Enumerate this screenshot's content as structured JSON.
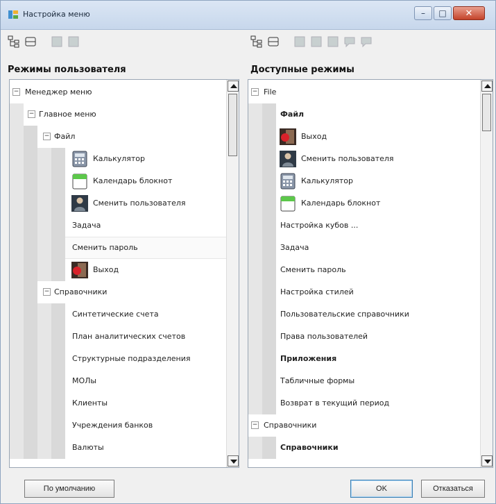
{
  "window": {
    "title": "Настройка меню",
    "min_glyph": "–",
    "max_glyph": "□",
    "close_glyph": "✕"
  },
  "left_panel": {
    "title": "Режимы пользователя",
    "rows": [
      {
        "label": "Менеджер меню",
        "toggle": "−"
      },
      {
        "label": "Главное меню",
        "toggle": "−"
      },
      {
        "label": "Файл",
        "toggle": "−"
      },
      {
        "label": "Калькулятор",
        "icon": "calculator-icon"
      },
      {
        "label": "Календарь блокнот",
        "icon": "calendar-icon"
      },
      {
        "label": "Сменить пользователя",
        "icon": "user-icon"
      },
      {
        "label": "Задача"
      },
      {
        "label": "Сменить пароль"
      },
      {
        "label": "Выход",
        "icon": "exit-icon"
      },
      {
        "label": "Справочники",
        "toggle": "−"
      },
      {
        "label": "Синтетические счета"
      },
      {
        "label": "План аналитических счетов"
      },
      {
        "label": "Структурные подразделения"
      },
      {
        "label": "МОЛы"
      },
      {
        "label": "Клиенты"
      },
      {
        "label": "Учреждения банков"
      },
      {
        "label": "Валюты"
      }
    ]
  },
  "right_panel": {
    "title": "Доступные режимы",
    "rows": [
      {
        "label": "File",
        "toggle": "−"
      },
      {
        "label": "Файл"
      },
      {
        "label": "Выход",
        "icon": "exit-icon"
      },
      {
        "label": "Сменить пользователя",
        "icon": "user-icon"
      },
      {
        "label": "Калькулятор",
        "icon": "calculator-icon"
      },
      {
        "label": "Календарь блокнот",
        "icon": "calendar-icon"
      },
      {
        "label": "Настройка кубов ..."
      },
      {
        "label": "Задача"
      },
      {
        "label": "Сменить пароль"
      },
      {
        "label": "Настройка стилей"
      },
      {
        "label": "Пользовательские справочники"
      },
      {
        "label": "Права пользователей"
      },
      {
        "label": "Приложения"
      },
      {
        "label": "Табличные формы"
      },
      {
        "label": "Возврат в текущий период"
      },
      {
        "label": "Справочники",
        "toggle": "−"
      },
      {
        "label": "Справочники"
      }
    ]
  },
  "buttons": {
    "default_label": "По умолчанию",
    "ok_label": "OK",
    "cancel_label": "Отказаться"
  }
}
